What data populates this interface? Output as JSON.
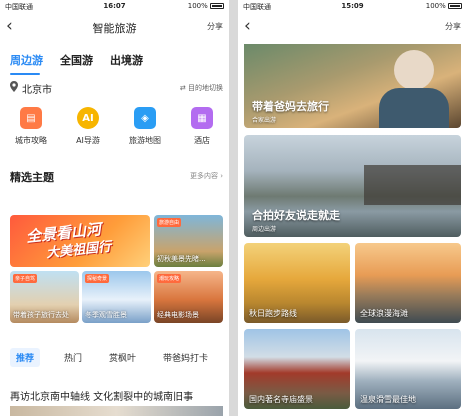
{
  "status_left": {
    "carrier": "中国联通",
    "time": "16:07",
    "battery": "100%"
  },
  "status_right": {
    "carrier": "中国联通",
    "time": "15:09",
    "battery": "100%"
  },
  "left": {
    "title": "智能旅游",
    "share": "分享",
    "tabs": [
      "周边游",
      "全国游",
      "出境游"
    ],
    "city": "北京市",
    "city_switch": "目的地切换",
    "quick": [
      {
        "label": "城市攻略",
        "icon": "city-guide-icon",
        "color": "#ff7a45"
      },
      {
        "label": "AI导游",
        "icon": "ai-guide-icon",
        "color": "#f7b500"
      },
      {
        "label": "旅游地图",
        "icon": "travel-map-icon",
        "color": "#2a9df4"
      },
      {
        "label": "酒店",
        "icon": "hotel-icon",
        "color": "#b36cf0"
      }
    ],
    "section_title": "精选主题",
    "section_more": "更多内容 ›",
    "banner": {
      "line1": "全景看山河",
      "line2": "大美祖国行"
    },
    "cards": [
      {
        "tag": "旅游自由",
        "caption": "初秋美景先睹..."
      },
      {
        "tag": "亲子自驾",
        "caption": "带着孩子旅行去处"
      },
      {
        "tag": "探秘奇景",
        "caption": "冬季观雪胜景"
      },
      {
        "tag": "潮玩攻略",
        "caption": "经典电影场景"
      }
    ],
    "categories": [
      "推荐",
      "热门",
      "赏枫叶",
      "带爸妈打卡"
    ],
    "article": "再访北京南中轴线 文化割裂中的城南旧事"
  },
  "right": {
    "share": "分享",
    "hero1": {
      "title": "带着爸妈去旅行",
      "sub": "合家出游"
    },
    "hero2": {
      "title": "合拍好友说走就走",
      "sub": "周边出游"
    },
    "grid": [
      "秋日跑步路线",
      "全球浪漫海滩",
      "国内著名寺庙盛景",
      "温泉滑雪最佳地"
    ]
  }
}
